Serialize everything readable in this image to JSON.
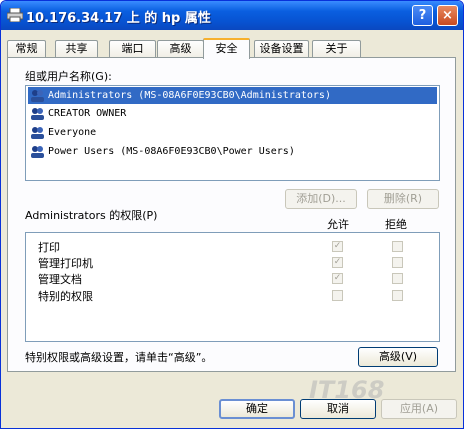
{
  "window": {
    "title": "10.176.34.17 上 的 hp 属性",
    "help_label": "?",
    "close_label": "×"
  },
  "tabs": [
    {
      "label": "常规"
    },
    {
      "label": "共享"
    },
    {
      "label": "端口"
    },
    {
      "label": "高级"
    },
    {
      "label": "安全",
      "active": true
    },
    {
      "label": "设备设置"
    },
    {
      "label": "关于"
    }
  ],
  "security": {
    "group_label": "组或用户名称(G):",
    "users": [
      {
        "name": "Administrators (MS-08A6F0E93CB0\\Administrators)",
        "icon": "user-group-icon",
        "selected": true
      },
      {
        "name": "CREATOR OWNER",
        "icon": "user-group-icon"
      },
      {
        "name": "Everyone",
        "icon": "user-group-icon"
      },
      {
        "name": "Power Users (MS-08A6F0E93CB0\\Power Users)",
        "icon": "user-group-icon"
      }
    ],
    "add_label": "添加(D)...",
    "remove_label": "删除(R)",
    "perm_label": "Administrators 的权限(P)",
    "allow_label": "允许",
    "deny_label": "拒绝",
    "permissions": [
      {
        "name": "打印",
        "allow": true,
        "deny": false
      },
      {
        "name": "管理打印机",
        "allow": true,
        "deny": false
      },
      {
        "name": "管理文档",
        "allow": true,
        "deny": false
      },
      {
        "name": "特别的权限",
        "allow": false,
        "deny": false
      }
    ],
    "advanced_hint": "特别权限或高级设置，请单击“高级”。",
    "advanced_label": "高级(V)"
  },
  "footer": {
    "ok_label": "确定",
    "cancel_label": "取消",
    "apply_label": "应用(A)"
  },
  "watermark": "IT168"
}
